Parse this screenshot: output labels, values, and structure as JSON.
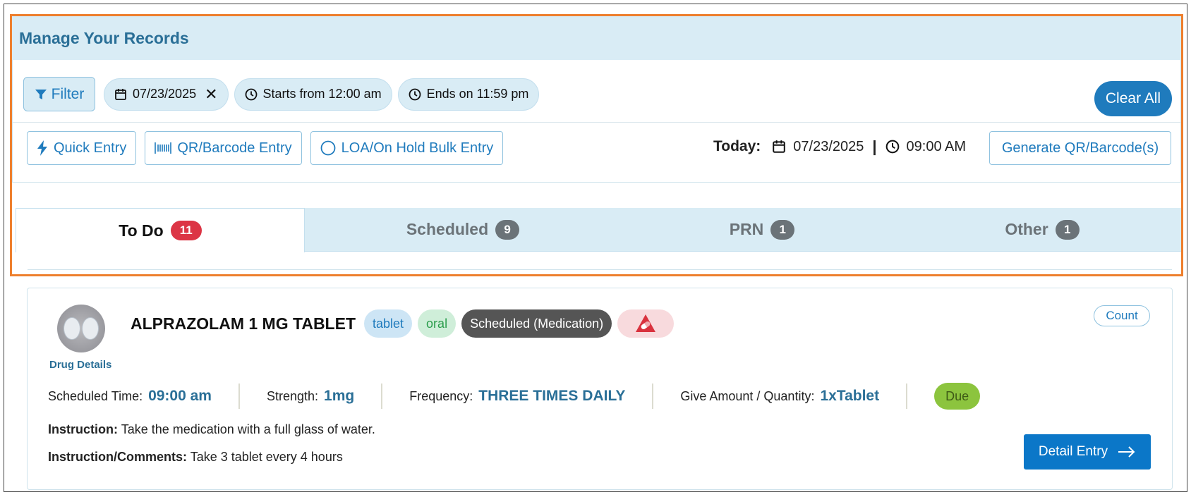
{
  "header": {
    "title": "Manage Your Records"
  },
  "filters": {
    "filter_label": "Filter",
    "date_chip": "07/23/2025",
    "start_chip": "Starts from 12:00 am",
    "end_chip": "Ends on 11:59 pm",
    "clear_all": "Clear All"
  },
  "actions": {
    "quick_entry": "Quick Entry",
    "qr_entry": "QR/Barcode Entry",
    "loa_entry": "LOA/On Hold Bulk Entry",
    "generate": "Generate QR/Barcode(s)"
  },
  "today": {
    "label": "Today:",
    "date": "07/23/2025",
    "separator": "|",
    "time": "09:00 AM"
  },
  "tabs": [
    {
      "label": "To Do",
      "count": "11"
    },
    {
      "label": "Scheduled",
      "count": "9"
    },
    {
      "label": "PRN",
      "count": "1"
    },
    {
      "label": "Other",
      "count": "1"
    }
  ],
  "card": {
    "drug_details_label": "Drug Details",
    "name": "ALPRAZOLAM 1 MG TABLET",
    "form": "tablet",
    "route": "oral",
    "schedule": "Scheduled (Medication)",
    "count_label": "Count",
    "meta": [
      {
        "key": "Scheduled Time:",
        "value": "09:00 am"
      },
      {
        "key": "Strength:",
        "value": "1mg"
      },
      {
        "key": "Frequency:",
        "value": "THREE TIMES DAILY"
      },
      {
        "key": "Give Amount / Quantity:",
        "value": "1xTablet"
      }
    ],
    "status": "Due",
    "instruction_label": "Instruction:",
    "instruction": "Take the medication with a full glass of water.",
    "comments_label": "Instruction/Comments:",
    "comments": "Take 3 tablet every 4 hours",
    "detail_button": "Detail Entry"
  },
  "colors": {
    "accent": "#1f7bbd",
    "highlight": "#ee7f2d",
    "badge_active": "#dc3545",
    "due": "#8cc43e"
  }
}
